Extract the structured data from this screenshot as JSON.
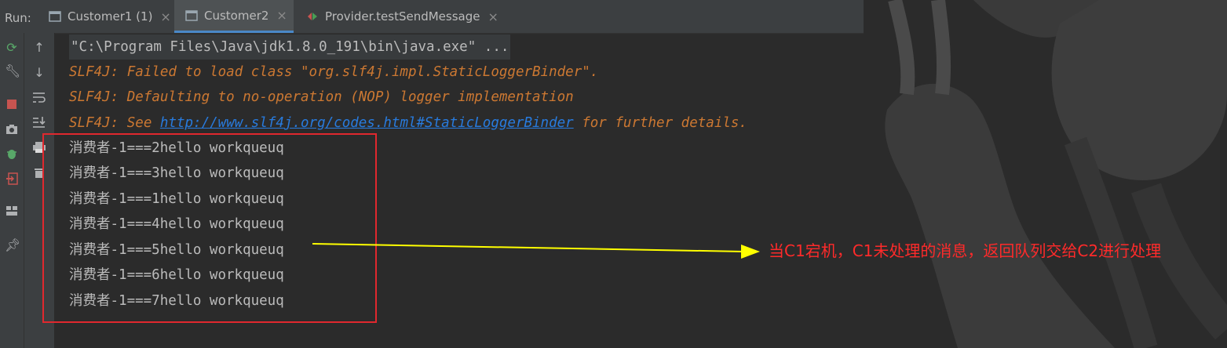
{
  "run_label": "Run:",
  "tabs": [
    {
      "label": "Customer1 (1)",
      "active": false
    },
    {
      "label": "Customer2",
      "active": true
    },
    {
      "label": "Provider.testSendMessage",
      "active": false
    }
  ],
  "console": {
    "command": "\"C:\\Program Files\\Java\\jdk1.8.0_191\\bin\\java.exe\" ...",
    "slf4j_line1": "SLF4J: Failed to load class \"org.slf4j.impl.StaticLoggerBinder\".",
    "slf4j_line2": "SLF4J: Defaulting to no-operation (NOP) logger implementation",
    "slf4j_line3_prefix": "SLF4J: See ",
    "slf4j_link": "http://www.slf4j.org/codes.html#StaticLoggerBinder",
    "slf4j_line3_suffix": " for further details.",
    "output_lines": [
      "消费者-1===2hello workqueuq",
      "消费者-1===3hello workqueuq",
      "消费者-1===1hello workqueuq",
      "消费者-1===4hello workqueuq",
      "消费者-1===5hello workqueuq",
      "消费者-1===6hello workqueuq",
      "消费者-1===7hello workqueuq"
    ]
  },
  "annotation": "当C1宕机，C1未处理的消息，返回队列交给C2进行处理",
  "colors": {
    "error_text": "#cc7832",
    "link": "#287bde",
    "highlight_box": "#e0282e",
    "arrow": "#ffff00",
    "annotation": "#ff2a2a"
  }
}
